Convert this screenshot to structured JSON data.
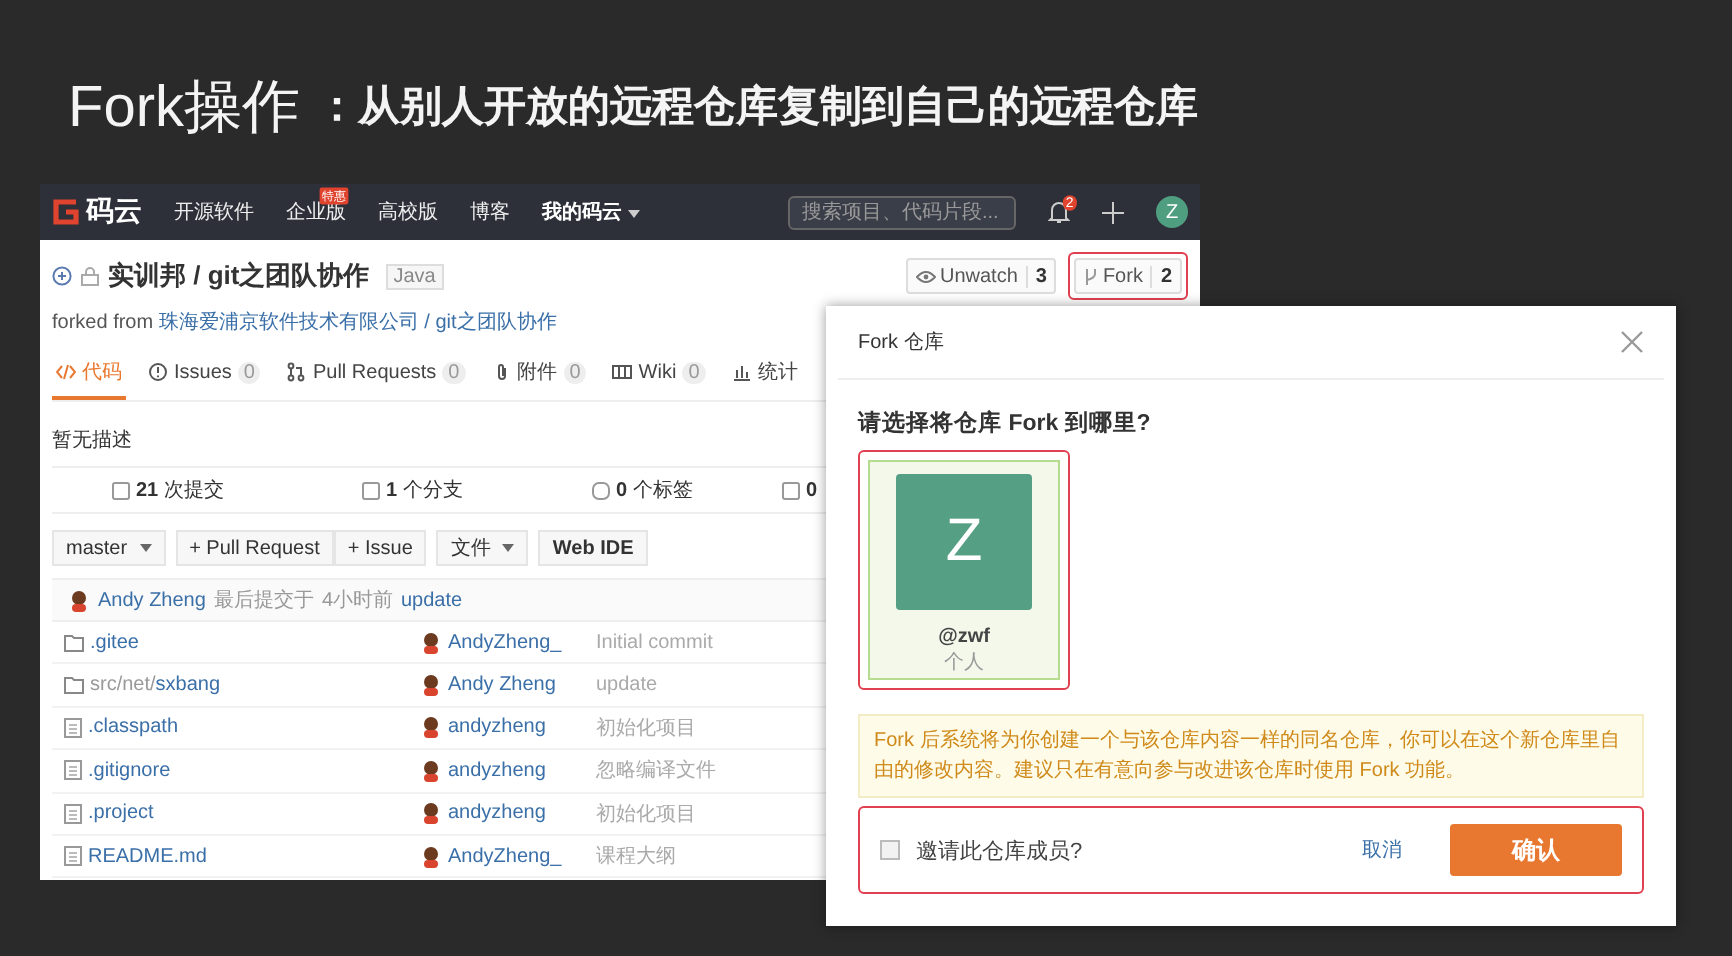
{
  "slide": {
    "title": "Fork操作",
    "subtitle": "：从别人开放的远程仓库复制到自己的远程仓库"
  },
  "navbar": {
    "logo_text": "码云",
    "items": [
      {
        "label": "开源软件"
      },
      {
        "label": "企业版",
        "badge": "特惠"
      },
      {
        "label": "高校版"
      },
      {
        "label": "博客"
      }
    ],
    "menu": "我的码云",
    "search": {
      "placeholder": "搜索项目、代码片段..."
    },
    "notification_count": "2",
    "avatar_letter": "Z"
  },
  "repo": {
    "path": "实训邦 / git之团队协作",
    "language": "Java",
    "watch": {
      "label": "Unwatch",
      "count": "3"
    },
    "fork": {
      "label": "Fork",
      "count": "2"
    },
    "forked_prefix": "forked from",
    "forked_link": "珠海爱浦京软件技术有限公司 / git之团队协作"
  },
  "tabs": [
    {
      "label": "代码",
      "selected": true
    },
    {
      "label": "Issues",
      "count": "0",
      "selected": false
    },
    {
      "label": "Pull Requests",
      "count": "0",
      "selected": false
    },
    {
      "label": "附件",
      "count": "0",
      "selected": false
    },
    {
      "label": "Wiki",
      "count": "0",
      "selected": false
    },
    {
      "label": "统计",
      "selected": false
    }
  ],
  "description": "暂无描述",
  "stats": [
    "**21** 次提交",
    "**1** 个分支",
    "**0** 个标签",
    "**0**"
  ],
  "actions": {
    "branch": "master",
    "buttons": [
      "+ Pull Request",
      "+ Issue"
    ],
    "file_menu": "文件",
    "web_ide": "Web IDE"
  },
  "last_commit": {
    "author": "Andy Zheng",
    "label": "最后提交于",
    "time": "4小时前",
    "message": "update"
  },
  "files": [
    {
      "kind": "folder",
      "name": ".gitee",
      "author": "AndyZheng_",
      "message": "Initial commit"
    },
    {
      "kind": "folder",
      "path": "src/net/",
      "name": "sxbang",
      "author": "Andy Zheng",
      "message": "update"
    },
    {
      "kind": "file",
      "name": ".classpath",
      "author": "andyzheng",
      "message": "初始化项目"
    },
    {
      "kind": "file",
      "name": ".gitignore",
      "author": "andyzheng",
      "message": "忽略编译文件"
    },
    {
      "kind": "file",
      "name": ".project",
      "author": "andyzheng",
      "message": "初始化项目"
    },
    {
      "kind": "file",
      "name": "README.md",
      "author": "AndyZheng_",
      "message": "课程大纲"
    }
  ],
  "modal": {
    "title": "Fork 仓库",
    "question": "请选择将仓库 Fork 到哪里?",
    "targets": [
      {
        "letter": "Z",
        "name": "@zwf",
        "type": "个人",
        "selected": true
      }
    ],
    "notice": "Fork 后系统将为你创建一个与该仓库内容一样的同名仓库，你可以在这个新仓库里自由的修改内容。建议只在有意向参与改进该仓库时使用 Fork 功能。",
    "invite": {
      "label": "邀请此仓库成员?",
      "checked": false
    },
    "cancel": "取消",
    "confirm": "确认"
  }
}
